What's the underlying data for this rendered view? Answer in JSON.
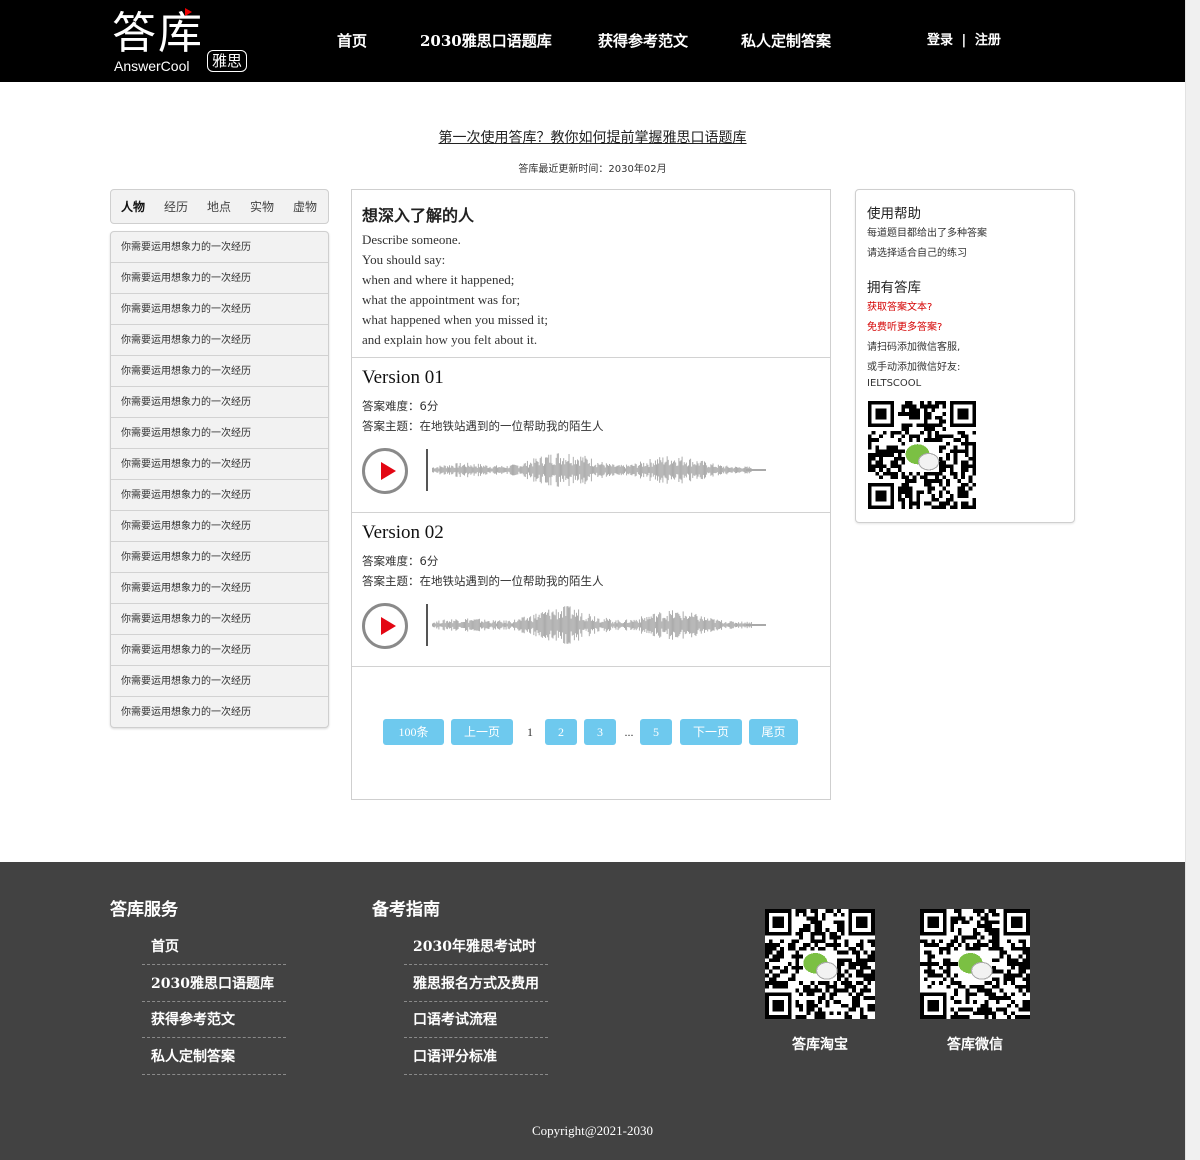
{
  "header": {
    "logo_main": "答库",
    "logo_en": "AnswerCool",
    "logo_badge": "雅思",
    "nav": [
      "首页",
      "2030雅思口语题库",
      "获得参考范文",
      "私人定制答案"
    ],
    "login": "登录",
    "divider": "|",
    "register": "注册"
  },
  "intro": {
    "link_text": "第一次使用答库？教你如何提前掌握雅思口语题库",
    "update_time": "答库最近更新时间：2030年02月"
  },
  "categories": {
    "tabs": [
      "人物",
      "经历",
      "地点",
      "实物",
      "虚物"
    ],
    "items": [
      "你需要运用想象力的一次经历",
      "你需要运用想象力的一次经历",
      "你需要运用想象力的一次经历",
      "你需要运用想象力的一次经历",
      "你需要运用想象力的一次经历",
      "你需要运用想象力的一次经历",
      "你需要运用想象力的一次经历",
      "你需要运用想象力的一次经历",
      "你需要运用想象力的一次经历",
      "你需要运用想象力的一次经历",
      "你需要运用想象力的一次经历",
      "你需要运用想象力的一次经历",
      "你需要运用想象力的一次经历",
      "你需要运用想象力的一次经历",
      "你需要运用想象力的一次经历",
      "你需要运用想象力的一次经历"
    ]
  },
  "question": {
    "title": "想深入了解的人",
    "lines": [
      "Describe someone.",
      "You should say:",
      "when and where it happened;",
      "what the appointment was for;",
      "what happened when you missed it;",
      "and explain how you felt about it."
    ]
  },
  "versions": [
    {
      "title": "Version 01",
      "difficulty": "答案难度：6分",
      "topic": "答案主题：在地铁站遇到的一位帮助我的陌生人"
    },
    {
      "title": "Version 02",
      "difficulty": "答案难度：6分",
      "topic": "答案主题：在地铁站遇到的一位帮助我的陌生人"
    }
  ],
  "pager": {
    "count": "100条",
    "prev": "上一页",
    "current": "1",
    "p2": "2",
    "p3": "3",
    "ellipsis": "...",
    "p5": "5",
    "next": "下一页",
    "last": "尾页"
  },
  "help": {
    "title1": "使用帮助",
    "line1": "每道题目都给出了多种答案",
    "line2": "请选择适合自己的练习",
    "title2": "拥有答库",
    "red1": "获取答案文本?",
    "red2": "免费听更多答案?",
    "line3": "请扫码添加微信客服,",
    "line4": "或手动添加微信好友:",
    "wechat_id": "IELTSCOOL"
  },
  "footer": {
    "col1_title": "答库服务",
    "col1_links": [
      "首页",
      "2030雅思口语题库",
      "获得参考范文",
      "私人定制答案"
    ],
    "col2_title": "备考指南",
    "col2_links": [
      "2030年雅思考试时",
      "雅思报名方式及费用",
      "口语考试流程",
      "口语评分标准"
    ],
    "qr1_caption": "答库淘宝",
    "qr2_caption": "答库微信",
    "copyright": "Copyright@2021-2030"
  },
  "colors": {
    "pager_blue": "#6ec9ee",
    "play_red": "#e30613",
    "notice_red": "#d40000",
    "footer_bg": "#424242"
  }
}
